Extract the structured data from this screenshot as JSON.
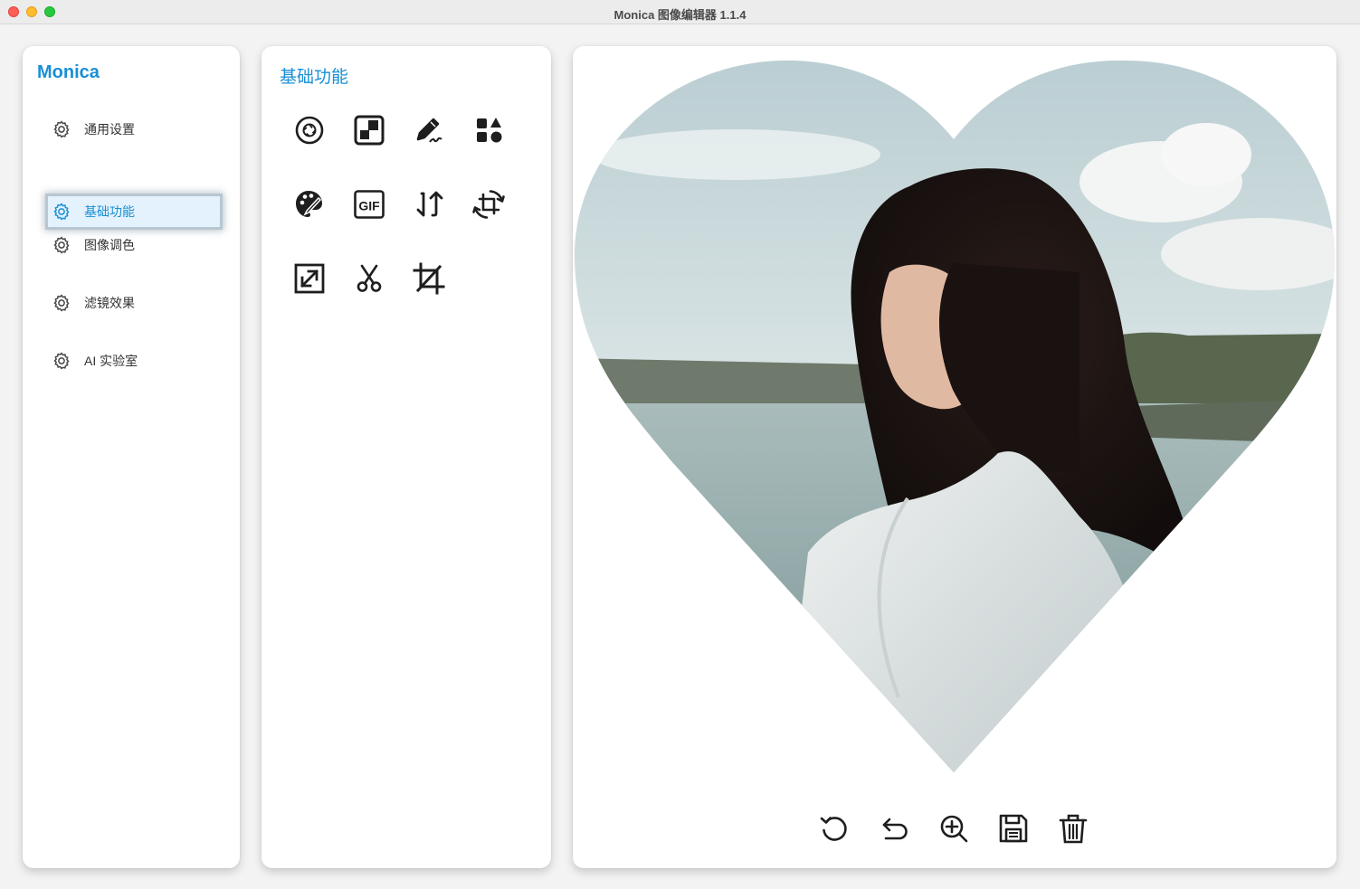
{
  "window": {
    "title": "Monica 图像编辑器 1.1.4"
  },
  "sidebar": {
    "brand": "Monica",
    "items": [
      {
        "label": "通用设置",
        "icon": "gear-icon",
        "active": false
      },
      {
        "label": "基础功能",
        "icon": "gear-icon",
        "active": true
      },
      {
        "label": "图像调色",
        "icon": "gear-icon",
        "active": false
      },
      {
        "label": "滤镜效果",
        "icon": "gear-icon",
        "active": false
      },
      {
        "label": "AI 实验室",
        "icon": "gear-icon",
        "active": false
      }
    ]
  },
  "tool_panel": {
    "title": "基础功能",
    "tools": [
      "aperture-icon",
      "mosaic-icon",
      "draw-icon",
      "shapes-icon",
      "palette-icon",
      "gif-icon",
      "flip-icon",
      "rotate-crop-icon",
      "resize-icon",
      "scissors-icon",
      "crop-icon"
    ],
    "gif_label": "GIF"
  },
  "canvas": {
    "image_mask": "heart",
    "toolbar": [
      "redo-icon",
      "undo-icon",
      "zoom-in-icon",
      "save-icon",
      "delete-icon"
    ]
  },
  "colors": {
    "accent": "#1a8fd6",
    "active_bg": "#e3f2fc",
    "icon": "#1e1e1e"
  }
}
